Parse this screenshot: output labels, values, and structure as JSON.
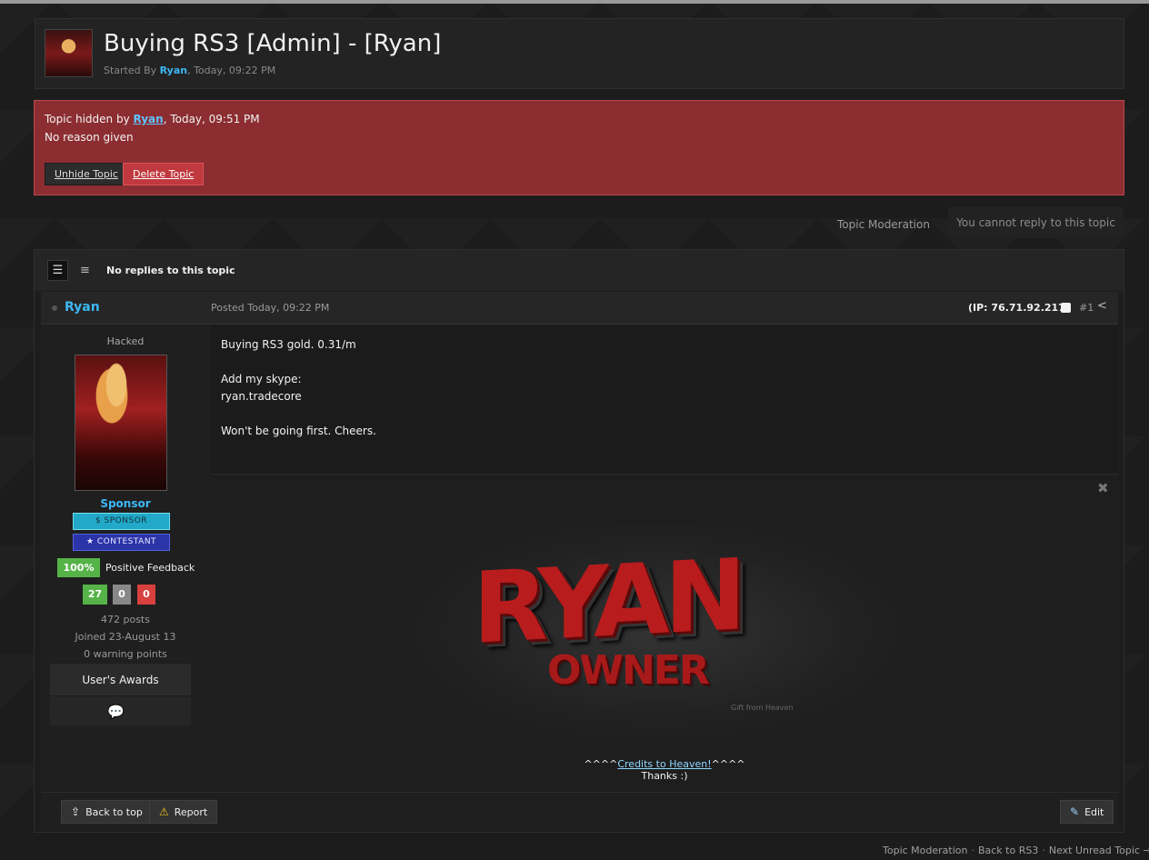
{
  "header": {
    "title": "Buying RS3 [Admin] - [Ryan]",
    "started_by": "Started By ",
    "author": "Ryan",
    "date": ", Today, 09:22 PM"
  },
  "hidden_notice": {
    "prefix": "Topic hidden by ",
    "user": "Ryan",
    "suffix": ", Today, 09:51 PM",
    "reason": "No reason given",
    "unhide_label": "Unhide Topic",
    "delete_label": "Delete Topic"
  },
  "moderation": {
    "label": "Topic Moderation",
    "no_reply": "You cannot reply to this topic"
  },
  "post_list": {
    "no_replies": "No replies to this topic"
  },
  "post": {
    "author": "Ryan",
    "posted": "Posted Today, 09:22 PM",
    "ip": "(IP: 76.71.92.217)",
    "number": "#1",
    "content": [
      "Buying RS3 gold. 0.31/m",
      "",
      "Add my skype:",
      "ryan.tradecore",
      "",
      "Won't be going first. Cheers."
    ]
  },
  "author_info": {
    "rank_title": "Hacked",
    "group": "Sponsor",
    "badge_sponsor": "SPONSOR",
    "badge_contestant": "CONTESTANT",
    "feedback_pct": "100%",
    "feedback_label": "Positive Feedback",
    "feedback_positive": "27",
    "feedback_neutral": "0",
    "feedback_negative": "0",
    "posts": "472 posts",
    "joined": "Joined 23-August 13",
    "warnings": "0 warning points",
    "awards_title": "User's Awards"
  },
  "signature": {
    "banner_main": "RYAN",
    "banner_sub": "OWNER",
    "banner_gift": "Gift from Heaven",
    "credits_prefix": "^^^^",
    "credits_link": "Credits to Heaven!",
    "credits_suffix": "^^^^",
    "thanks": "Thanks :)"
  },
  "footer": {
    "back_to_top": "Back to top",
    "report": "Report",
    "edit": "Edit"
  },
  "bottom_links": {
    "moderation": "Topic Moderation",
    "back": "Back to RS3",
    "next": "Next Unread Topic →"
  },
  "colors": {
    "accent": "#3db8f5",
    "hidden_bg": "#8c2d31",
    "delete_btn": "#c0393e",
    "feedback_green": "#55b347",
    "feedback_red": "#d8403e"
  }
}
